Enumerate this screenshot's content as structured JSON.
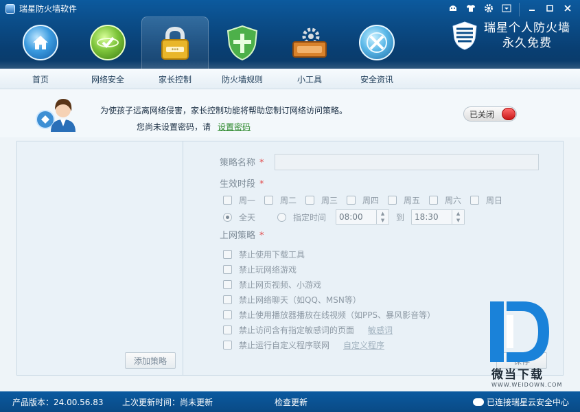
{
  "window": {
    "title": "瑞星防火墙软件",
    "controls": [
      "skin",
      "shirt",
      "settings",
      "menu",
      "minimize",
      "maximize",
      "close"
    ]
  },
  "brand": {
    "line1": "瑞星个人防火墙",
    "line2": "永久免费"
  },
  "nav": {
    "tabs": [
      {
        "label": "首页",
        "icon": "home-icon"
      },
      {
        "label": "网络安全",
        "icon": "network-security-icon"
      },
      {
        "label": "家长控制",
        "icon": "padlock-icon",
        "active": true
      },
      {
        "label": "防火墙规则",
        "icon": "shield-icon"
      },
      {
        "label": "小工具",
        "icon": "toolbox-icon"
      },
      {
        "label": "安全资讯",
        "icon": "globe-info-icon"
      }
    ]
  },
  "notice": {
    "line1": "为使孩子远离网络侵害，家长控制功能将帮助您制订网络访问策略。",
    "line2": "您尚未设置密码，请",
    "link": "设置密码",
    "toggle_label": "已关闭"
  },
  "left_pane": {
    "add_button": "添加策略"
  },
  "form": {
    "name_label": "策略名称",
    "name_value": "",
    "time_label": "生效时段",
    "days": [
      "周一",
      "周二",
      "周三",
      "周四",
      "周五",
      "周六",
      "周日"
    ],
    "all_day": "全天",
    "specified_time": "指定时间",
    "start_time": "08:00",
    "to": "到",
    "end_time": "18:30",
    "policy_label": "上网策略",
    "required_mark": "*",
    "policies": [
      {
        "label": "禁止使用下载工具",
        "link": ""
      },
      {
        "label": "禁止玩网络游戏",
        "link": ""
      },
      {
        "label": "禁止网页视频、小游戏",
        "link": ""
      },
      {
        "label": "禁止网络聊天（如QQ、MSN等）",
        "link": ""
      },
      {
        "label": "禁止使用播放器播放在线视频（如PPS、暴风影音等）",
        "link": ""
      },
      {
        "label": "禁止访问含有指定敏感词的页面",
        "link": "敏感词"
      },
      {
        "label": "禁止运行自定义程序联网",
        "link": "自定义程序"
      }
    ],
    "save_button": "保存"
  },
  "watermark": {
    "text": "微当下载",
    "url": "WWW.WEIDOWN.COM"
  },
  "statusbar": {
    "version": "产品版本：24.00.56.83",
    "last_update": "上次更新时间：尚未更新",
    "check_update": "检查更新",
    "cloud": "已连接瑞星云安全中心"
  },
  "colors": {
    "header": "#0b4e8a",
    "statusbar": "#0a5296",
    "toggle_off": "#c81717",
    "link": "#2f8a2f"
  }
}
